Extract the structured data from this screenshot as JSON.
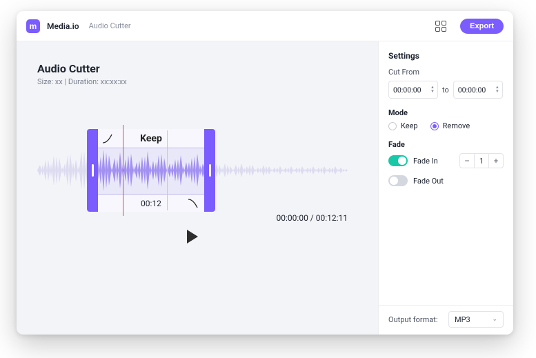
{
  "colors": {
    "accent": "#7b5cff",
    "toggle_on": "#17c9a6"
  },
  "header": {
    "brand": "Media.io",
    "crumb": "Audio Cutter",
    "export_label": "Export"
  },
  "main": {
    "title": "Audio Cutter",
    "meta": "Size: xx | Duration: xx:xx:xx",
    "selection": {
      "label": "Keep",
      "time": "00:12"
    },
    "time_display": "00:00:00 / 00:12:11"
  },
  "settings": {
    "title": "Settings",
    "cut_from_label": "Cut From",
    "cut_from_value": "00:00:00",
    "to_label": "to",
    "cut_to_value": "00:00:00",
    "mode_title": "Mode",
    "mode_options": {
      "keep": "Keep",
      "remove": "Remove"
    },
    "mode_selected": "remove",
    "fade_title": "Fade",
    "fade_in_label": "Fade In",
    "fade_in_on": true,
    "fade_in_value": "1",
    "fade_out_label": "Fade Out",
    "fade_out_on": false
  },
  "footer": {
    "output_label": "Output format:",
    "output_value": "MP3"
  }
}
